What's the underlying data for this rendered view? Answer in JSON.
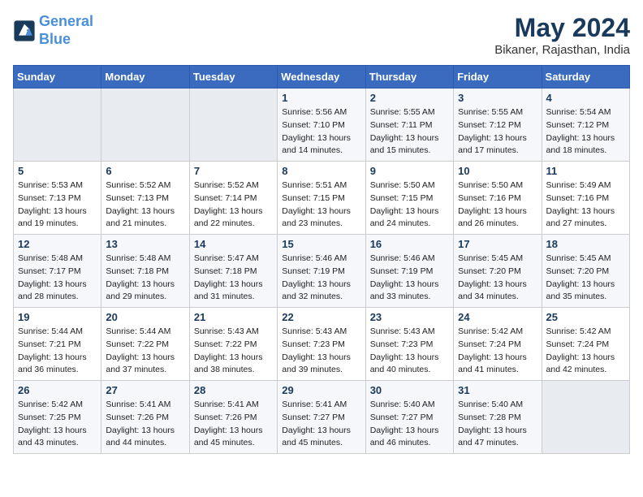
{
  "header": {
    "logo_line1": "General",
    "logo_line2": "Blue",
    "month_title": "May 2024",
    "location": "Bikaner, Rajasthan, India"
  },
  "weekdays": [
    "Sunday",
    "Monday",
    "Tuesday",
    "Wednesday",
    "Thursday",
    "Friday",
    "Saturday"
  ],
  "weeks": [
    [
      {
        "day": "",
        "info": ""
      },
      {
        "day": "",
        "info": ""
      },
      {
        "day": "",
        "info": ""
      },
      {
        "day": "1",
        "info": "Sunrise: 5:56 AM\nSunset: 7:10 PM\nDaylight: 13 hours\nand 14 minutes."
      },
      {
        "day": "2",
        "info": "Sunrise: 5:55 AM\nSunset: 7:11 PM\nDaylight: 13 hours\nand 15 minutes."
      },
      {
        "day": "3",
        "info": "Sunrise: 5:55 AM\nSunset: 7:12 PM\nDaylight: 13 hours\nand 17 minutes."
      },
      {
        "day": "4",
        "info": "Sunrise: 5:54 AM\nSunset: 7:12 PM\nDaylight: 13 hours\nand 18 minutes."
      }
    ],
    [
      {
        "day": "5",
        "info": "Sunrise: 5:53 AM\nSunset: 7:13 PM\nDaylight: 13 hours\nand 19 minutes."
      },
      {
        "day": "6",
        "info": "Sunrise: 5:52 AM\nSunset: 7:13 PM\nDaylight: 13 hours\nand 21 minutes."
      },
      {
        "day": "7",
        "info": "Sunrise: 5:52 AM\nSunset: 7:14 PM\nDaylight: 13 hours\nand 22 minutes."
      },
      {
        "day": "8",
        "info": "Sunrise: 5:51 AM\nSunset: 7:15 PM\nDaylight: 13 hours\nand 23 minutes."
      },
      {
        "day": "9",
        "info": "Sunrise: 5:50 AM\nSunset: 7:15 PM\nDaylight: 13 hours\nand 24 minutes."
      },
      {
        "day": "10",
        "info": "Sunrise: 5:50 AM\nSunset: 7:16 PM\nDaylight: 13 hours\nand 26 minutes."
      },
      {
        "day": "11",
        "info": "Sunrise: 5:49 AM\nSunset: 7:16 PM\nDaylight: 13 hours\nand 27 minutes."
      }
    ],
    [
      {
        "day": "12",
        "info": "Sunrise: 5:48 AM\nSunset: 7:17 PM\nDaylight: 13 hours\nand 28 minutes."
      },
      {
        "day": "13",
        "info": "Sunrise: 5:48 AM\nSunset: 7:18 PM\nDaylight: 13 hours\nand 29 minutes."
      },
      {
        "day": "14",
        "info": "Sunrise: 5:47 AM\nSunset: 7:18 PM\nDaylight: 13 hours\nand 31 minutes."
      },
      {
        "day": "15",
        "info": "Sunrise: 5:46 AM\nSunset: 7:19 PM\nDaylight: 13 hours\nand 32 minutes."
      },
      {
        "day": "16",
        "info": "Sunrise: 5:46 AM\nSunset: 7:19 PM\nDaylight: 13 hours\nand 33 minutes."
      },
      {
        "day": "17",
        "info": "Sunrise: 5:45 AM\nSunset: 7:20 PM\nDaylight: 13 hours\nand 34 minutes."
      },
      {
        "day": "18",
        "info": "Sunrise: 5:45 AM\nSunset: 7:20 PM\nDaylight: 13 hours\nand 35 minutes."
      }
    ],
    [
      {
        "day": "19",
        "info": "Sunrise: 5:44 AM\nSunset: 7:21 PM\nDaylight: 13 hours\nand 36 minutes."
      },
      {
        "day": "20",
        "info": "Sunrise: 5:44 AM\nSunset: 7:22 PM\nDaylight: 13 hours\nand 37 minutes."
      },
      {
        "day": "21",
        "info": "Sunrise: 5:43 AM\nSunset: 7:22 PM\nDaylight: 13 hours\nand 38 minutes."
      },
      {
        "day": "22",
        "info": "Sunrise: 5:43 AM\nSunset: 7:23 PM\nDaylight: 13 hours\nand 39 minutes."
      },
      {
        "day": "23",
        "info": "Sunrise: 5:43 AM\nSunset: 7:23 PM\nDaylight: 13 hours\nand 40 minutes."
      },
      {
        "day": "24",
        "info": "Sunrise: 5:42 AM\nSunset: 7:24 PM\nDaylight: 13 hours\nand 41 minutes."
      },
      {
        "day": "25",
        "info": "Sunrise: 5:42 AM\nSunset: 7:24 PM\nDaylight: 13 hours\nand 42 minutes."
      }
    ],
    [
      {
        "day": "26",
        "info": "Sunrise: 5:42 AM\nSunset: 7:25 PM\nDaylight: 13 hours\nand 43 minutes."
      },
      {
        "day": "27",
        "info": "Sunrise: 5:41 AM\nSunset: 7:26 PM\nDaylight: 13 hours\nand 44 minutes."
      },
      {
        "day": "28",
        "info": "Sunrise: 5:41 AM\nSunset: 7:26 PM\nDaylight: 13 hours\nand 45 minutes."
      },
      {
        "day": "29",
        "info": "Sunrise: 5:41 AM\nSunset: 7:27 PM\nDaylight: 13 hours\nand 45 minutes."
      },
      {
        "day": "30",
        "info": "Sunrise: 5:40 AM\nSunset: 7:27 PM\nDaylight: 13 hours\nand 46 minutes."
      },
      {
        "day": "31",
        "info": "Sunrise: 5:40 AM\nSunset: 7:28 PM\nDaylight: 13 hours\nand 47 minutes."
      },
      {
        "day": "",
        "info": ""
      }
    ]
  ]
}
